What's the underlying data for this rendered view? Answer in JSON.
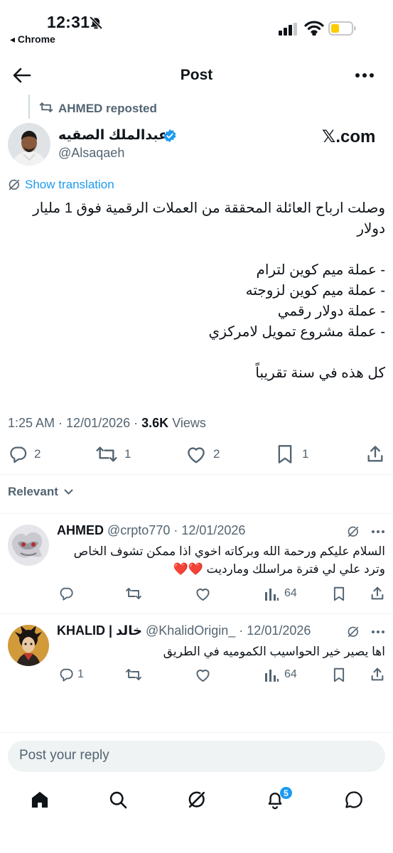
{
  "status_bar": {
    "time": "12:31",
    "back_app": "◂ Chrome"
  },
  "header": {
    "title": "Post"
  },
  "repost": {
    "text": "AHMED reposted"
  },
  "tweet": {
    "author_name": "عبدالملك الصقيه",
    "handle": "@Alsaqaeh",
    "brand": "𝕏.com",
    "show_translation": "Show translation",
    "body": "وصلت ارباح العائلة المحققة من العملات الرقمية فوق 1 مليار دولار\n\n- عملة ميم كوين لترام\n- عملة ميم كوين لزوجته\n- عملة دولار رقمي\n- عملة مشروع تمويل لامركزي\n\nكل هذه في سنة تقريباً",
    "time": "1:25 AM",
    "date": "12/01/2026",
    "views_count": "3.6K",
    "views_label": "Views",
    "sep": " · ",
    "replies": "2",
    "reposts": "1",
    "likes": "2",
    "bookmarks": "1"
  },
  "sort": {
    "label": "Relevant"
  },
  "replies": [
    {
      "name": "AHMED",
      "handle": "@crpto770",
      "date": "· 12/01/2026",
      "text": "السلام عليكم ورحمة الله وبركاته اخوي اذا ممكن تشوف الخاص وترد علي لي فترة مراسلك ومارديت ❤️❤️",
      "replies": "",
      "views": "64"
    },
    {
      "name": "KHALID | خالد",
      "handle": "@KhalidOrigin_",
      "date": "· 12/01/2026",
      "text": "اها يصير خير الحواسيب الكموميه في الطريق",
      "replies": "1",
      "views": "64"
    }
  ],
  "composer": {
    "placeholder": "Post your reply"
  },
  "bottom_nav": {
    "notifications_badge": "5"
  },
  "colors": {
    "accent": "#1d9bf0",
    "text": "#0f1419",
    "muted": "#536471",
    "like": "#e0245e"
  }
}
